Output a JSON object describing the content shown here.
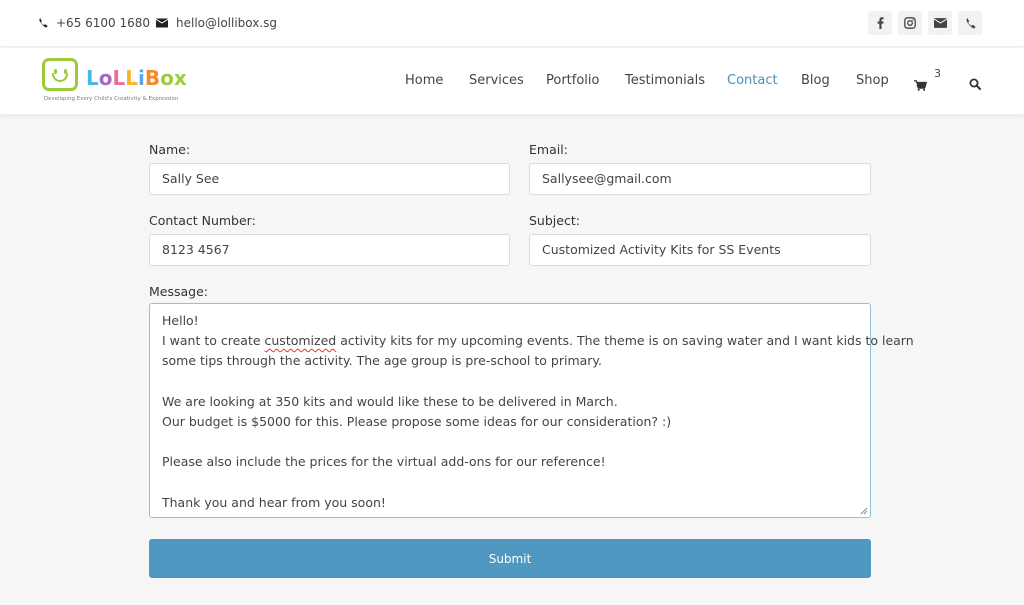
{
  "topbar": {
    "phone": "+65 6100 1680",
    "email": "hello@lollibox.sg",
    "socials": [
      {
        "icon": "facebook-icon"
      },
      {
        "icon": "instagram-icon"
      },
      {
        "icon": "envelope-icon"
      },
      {
        "icon": "phone-icon"
      }
    ]
  },
  "brand": {
    "name_letters": [
      {
        "ch": "L",
        "color": "#4bb7e6"
      },
      {
        "ch": "o",
        "color": "#a06bc2"
      },
      {
        "ch": "L",
        "color": "#f06a9c"
      },
      {
        "ch": "L",
        "color": "#f7b52b"
      },
      {
        "ch": "i",
        "color": "#5aa9e6"
      },
      {
        "ch": "B",
        "color": "#f58a2c"
      },
      {
        "ch": "o",
        "color": "#9ccb3b"
      },
      {
        "ch": "x",
        "color": "#9ccb3b"
      }
    ],
    "tagline": "Developing Every Child's Creativity & Expression",
    "logo_color": "#9ccb3b"
  },
  "nav": {
    "items": [
      {
        "label": "Home",
        "active": false
      },
      {
        "label": "Services",
        "active": false
      },
      {
        "label": "Portfolio",
        "active": false
      },
      {
        "label": "Testimonials",
        "active": false
      },
      {
        "label": "Contact",
        "active": true
      },
      {
        "label": "Blog",
        "active": false
      },
      {
        "label": "Shop",
        "active": false
      }
    ],
    "cart_count": "3",
    "active_color": "#4a90b8"
  },
  "form": {
    "name_label": "Name:",
    "name_value": "Sally See",
    "email_label": "Email:",
    "email_value": "Sallysee@gmail.com",
    "contact_label": "Contact Number:",
    "contact_value": "8123 4567",
    "subject_label": "Subject:",
    "subject_value": "Customized Activity Kits for SS Events",
    "message_label": "Message:",
    "message_lines": [
      "Hello!",
      "I want to create customized activity kits for my upcoming events. The theme is on saving water and I want kids to learn",
      "some tips through the activity. The age group is pre-school to primary.",
      "",
      "We are looking at 350 kits and would like these to be delivered in March.",
      "Our budget is $5000 for this. Please propose some ideas for our consideration? :)",
      "",
      "Please also include the prices for the virtual add-ons for our reference!",
      "",
      "Thank you and hear from you soon!"
    ],
    "message_misspelled_word": "customized",
    "submit_label": "Submit",
    "submit_color": "#4e98c2"
  }
}
